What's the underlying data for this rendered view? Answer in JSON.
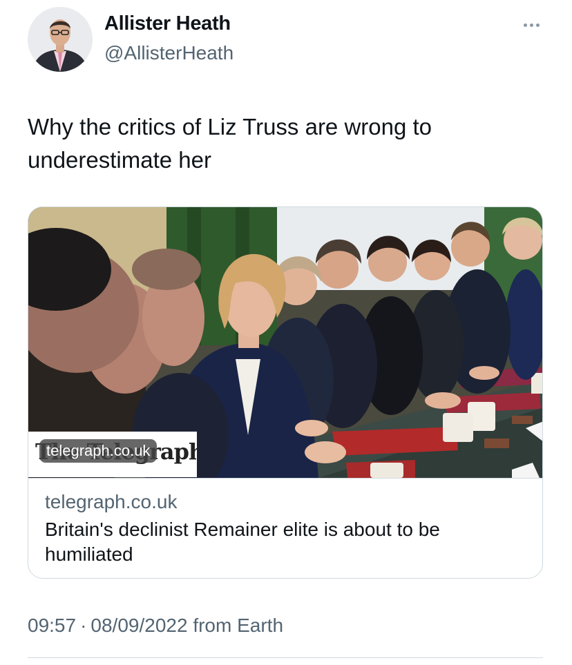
{
  "author": {
    "display_name": "Allister Heath",
    "handle": "@AllisterHeath",
    "avatar_icon": "profile-photo"
  },
  "more_icon": "ellipsis-icon",
  "tweet": {
    "text": "Why the critics of Liz Truss are wrong to underestimate her"
  },
  "link_card": {
    "image_badge": "telegraph.co.uk",
    "masthead_logo": "The Telegraph",
    "domain": "telegraph.co.uk",
    "title": "Britain's declinist Remainer elite is about to be humiliated"
  },
  "meta": {
    "time": "09:57",
    "separator": "·",
    "date": "08/09/2022",
    "source": "from Earth"
  },
  "colors": {
    "text": "#0f1419",
    "secondary": "#536471",
    "border": "#cfd9de"
  }
}
